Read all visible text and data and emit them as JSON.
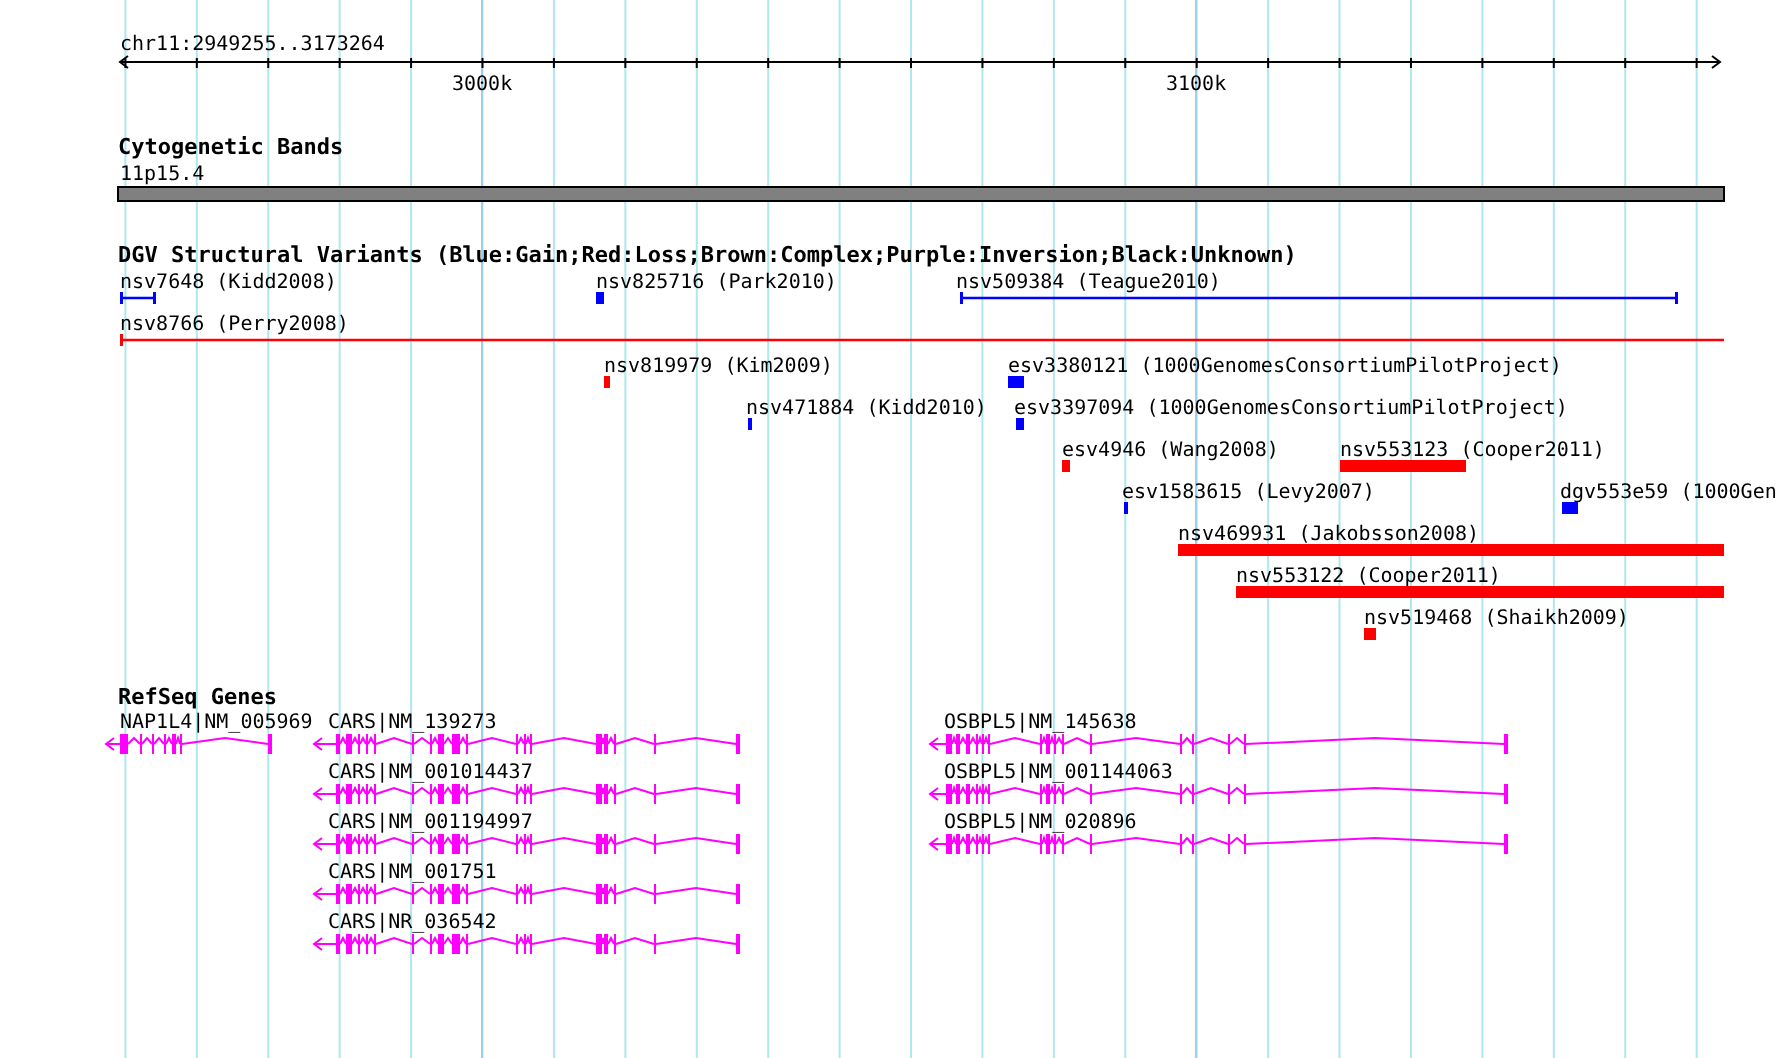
{
  "ruler": {
    "region": "chr11:2949255..3173264",
    "tick_labels": [
      "3000k",
      "3100k"
    ]
  },
  "tracks": [
    {
      "kind": "bands",
      "title": "Cytogenetic Bands",
      "features": [
        {
          "label": "11p15.4"
        }
      ]
    },
    {
      "kind": "variants",
      "title": "DGV Structural Variants (Blue:Gain;Red:Loss;Brown:Complex;Purple:Inversion;Black:Unknown)",
      "features": [
        {
          "label": "nsv7648 (Kidd2008)",
          "color": "#0000ff"
        },
        {
          "label": "nsv825716 (Park2010)",
          "color": "#0000ff"
        },
        {
          "label": "nsv509384 (Teague2010)",
          "color": "#0000ff"
        },
        {
          "label": "nsv8766 (Perry2008)",
          "color": "#ff0000"
        },
        {
          "label": "nsv819979 (Kim2009)",
          "color": "#ff0000"
        },
        {
          "label": "esv3380121 (1000GenomesConsortiumPilotProject)",
          "color": "#0000ff"
        },
        {
          "label": "nsv471884 (Kidd2010)",
          "color": "#0000ff"
        },
        {
          "label": "esv3397094 (1000GenomesConsortiumPilotProject)",
          "color": "#0000ff"
        },
        {
          "label": "esv4946 (Wang2008)",
          "color": "#ff0000"
        },
        {
          "label": "nsv553123 (Cooper2011)",
          "color": "#ff0000"
        },
        {
          "label": "esv1583615 (Levy2007)",
          "color": "#0000ff"
        },
        {
          "label": "dgv553e59 (1000Gen",
          "color": "#0000ff"
        },
        {
          "label": "nsv469931 (Jakobsson2008)",
          "color": "#ff0000"
        },
        {
          "label": "nsv553122 (Cooper2011)",
          "color": "#ff0000"
        },
        {
          "label": "nsv519468 (Shaikh2009)",
          "color": "#ff0000"
        }
      ]
    },
    {
      "kind": "genes",
      "title": "RefSeq Genes",
      "features": [
        {
          "label": "NAP1L4|NM_005969"
        },
        {
          "label": "CARS|NM_139273"
        },
        {
          "label": "OSBPL5|NM_145638"
        },
        {
          "label": "CARS|NM_001014437"
        },
        {
          "label": "OSBPL5|NM_001144063"
        },
        {
          "label": "CARS|NM_001194997"
        },
        {
          "label": "OSBPL5|NM_020896"
        },
        {
          "label": "CARS|NM_001751"
        },
        {
          "label": "CARS|NR_036542"
        }
      ]
    }
  ]
}
